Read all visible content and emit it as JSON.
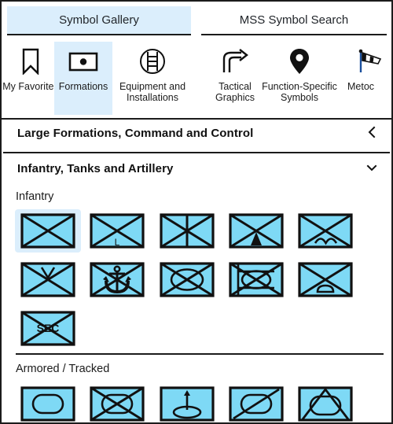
{
  "window": {
    "title": "Symbol Gallery"
  },
  "tabs": [
    {
      "label": "Symbol Gallery",
      "active": true
    },
    {
      "label": "MSS Symbol Search",
      "active": false
    }
  ],
  "categories": [
    {
      "label": "My Favorites",
      "icon": "bookmark-icon",
      "selected": false
    },
    {
      "label": "Formations",
      "icon": "formation-rectangle-dot-icon",
      "selected": true
    },
    {
      "label": "Equipment and Installations",
      "icon": "circle-ladder-icon",
      "selected": false
    },
    {
      "label": "Tactical Graphics",
      "icon": "curved-arrow-icon",
      "selected": false
    },
    {
      "label": "Function-Specific Symbols",
      "icon": "map-pin-icon",
      "selected": false
    },
    {
      "label": "Metoc",
      "icon": "windsock-icon",
      "selected": false
    }
  ],
  "sections": [
    {
      "title": "Large Formations, Command and Control",
      "expanded": false,
      "chevron": "chevron-left-icon"
    },
    {
      "title": "Infantry, Tanks and Artillery",
      "expanded": true,
      "chevron": "chevron-down-icon"
    }
  ],
  "groups": [
    {
      "label": "Infantry",
      "symbols": [
        {
          "name": "infantry",
          "modifier": ""
        },
        {
          "name": "infantry-light",
          "modifier": "L"
        },
        {
          "name": "infantry-motorized",
          "modifier": ""
        },
        {
          "name": "infantry-mountain",
          "modifier": ""
        },
        {
          "name": "infantry-airborne",
          "modifier": ""
        },
        {
          "name": "infantry-air-assault",
          "modifier": ""
        },
        {
          "name": "infantry-naval-marine",
          "modifier": ""
        },
        {
          "name": "infantry-mechanized",
          "modifier": ""
        },
        {
          "name": "infantry-mechanized-tracked",
          "modifier": ""
        },
        {
          "name": "infantry-amphibious",
          "modifier": ""
        },
        {
          "name": "infantry-security",
          "modifier": "SEC"
        }
      ]
    },
    {
      "label": "Armored / Tracked",
      "symbols": [
        {
          "name": "armored-tracked",
          "modifier": ""
        },
        {
          "name": "armored-reconnaissance",
          "modifier": ""
        },
        {
          "name": "armored-antitank",
          "modifier": ""
        },
        {
          "name": "armored-wheeled",
          "modifier": ""
        },
        {
          "name": "armored-air-defense",
          "modifier": ""
        }
      ]
    }
  ],
  "colors": {
    "accent": "#dbeefc",
    "symbol_fill": "#7ed9f5",
    "outline": "#111111",
    "text": "#1b1b1b"
  }
}
